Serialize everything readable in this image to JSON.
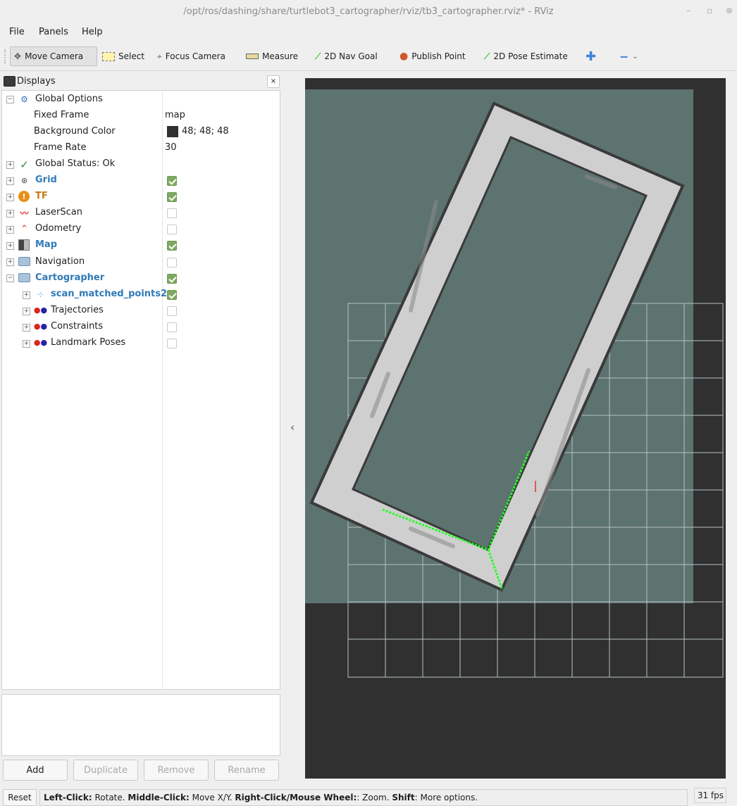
{
  "window": {
    "title": "/opt/ros/dashing/share/turtlebot3_cartographer/rviz/tb3_cartographer.rviz* - RViz"
  },
  "menu": {
    "file": "File",
    "panels": "Panels",
    "help": "Help"
  },
  "toolbar": {
    "move_camera": "Move Camera",
    "select": "Select",
    "focus_camera": "Focus Camera",
    "measure": "Measure",
    "nav_goal": "2D Nav Goal",
    "publish_point": "Publish Point",
    "pose_estimate": "2D Pose Estimate"
  },
  "displays": {
    "title": "Displays",
    "close": "×",
    "global_options": "Global Options",
    "fixed_frame_label": "Fixed Frame",
    "fixed_frame_value": "map",
    "bg_color_label": "Background Color",
    "bg_color_value": "48; 48; 48",
    "bg_color_hex": "#303030",
    "frame_rate_label": "Frame Rate",
    "frame_rate_value": "30",
    "global_status": "Global Status: Ok",
    "grid": "Grid",
    "tf": "TF",
    "laserscan": "LaserScan",
    "odometry": "Odometry",
    "map": "Map",
    "navigation": "Navigation",
    "cartographer": "Cartographer",
    "scan_matched_points": "scan_matched_points2",
    "trajectories": "Trajectories",
    "constraints": "Constraints",
    "landmark_poses": "Landmark Poses",
    "checks": {
      "grid": true,
      "tf": true,
      "laserscan": false,
      "odometry": false,
      "map": true,
      "navigation": false,
      "cartographer": true,
      "scan_matched_points": true,
      "trajectories": false,
      "constraints": false,
      "landmark_poses": false
    }
  },
  "buttons": {
    "add": "Add",
    "duplicate": "Duplicate",
    "remove": "Remove",
    "rename": "Rename"
  },
  "status": {
    "reset": "Reset",
    "left_click_key": "Left-Click:",
    "left_click_val": " Rotate. ",
    "middle_click_key": "Middle-Click:",
    "middle_click_val": " Move X/Y. ",
    "right_click_key": "Right-Click/Mouse Wheel:",
    "right_click_val": ": Zoom. ",
    "shift_key": "Shift",
    "shift_val": ": More options.",
    "fps": "31 fps"
  },
  "colors": {
    "accent_blue": "#2f7ab7",
    "tf_orange": "#c67b17",
    "check_green": "#7fa862",
    "scan_green": "#22ff22"
  }
}
